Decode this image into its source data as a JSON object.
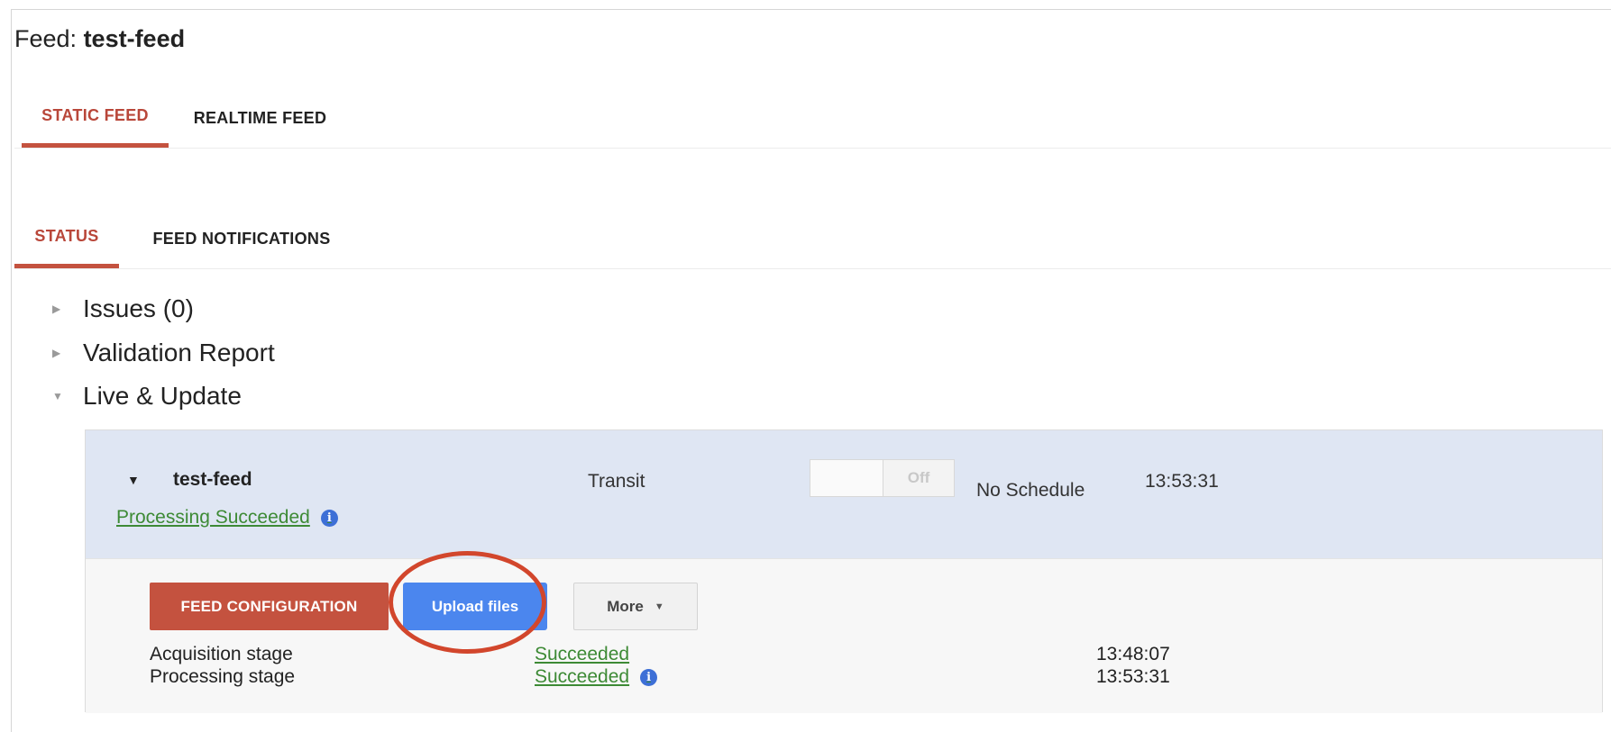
{
  "page": {
    "title_prefix": "Feed:",
    "title_name": "test-feed"
  },
  "top_tabs": [
    {
      "label": "STATIC FEED",
      "active": true
    },
    {
      "label": "REALTIME FEED",
      "active": false
    }
  ],
  "sub_tabs": [
    {
      "label": "STATUS",
      "active": true
    },
    {
      "label": "FEED NOTIFICATIONS",
      "active": false
    }
  ],
  "tree": [
    {
      "label": "Issues (0)",
      "expanded": false
    },
    {
      "label": "Validation Report",
      "expanded": false
    },
    {
      "label": "Live & Update",
      "expanded": true
    }
  ],
  "feed": {
    "name": "test-feed",
    "status_link": "Processing Succeeded",
    "type": "Transit",
    "toggle_label": "Off",
    "schedule": "No Schedule",
    "time": "13:53:31",
    "buttons": {
      "config": "FEED CONFIGURATION",
      "upload": "Upload files",
      "more": "More"
    },
    "stages": [
      {
        "label": "Acquisition stage",
        "status": "Succeeded",
        "time": "13:48:07",
        "info": false
      },
      {
        "label": "Processing stage",
        "status": "Succeeded",
        "time": "13:53:31",
        "info": true
      }
    ]
  },
  "colors": {
    "accent_red": "#c4523f",
    "link_green": "#3d8a35",
    "upload_blue": "#4b86ee",
    "head_bg": "#dfe6f3",
    "annotation_ring": "#d2462c"
  },
  "icons": {
    "info": "info-circle-icon",
    "collapsed": "triangle-right-icon",
    "expanded": "triangle-down-icon",
    "dropdown": "chevron-down-icon"
  }
}
